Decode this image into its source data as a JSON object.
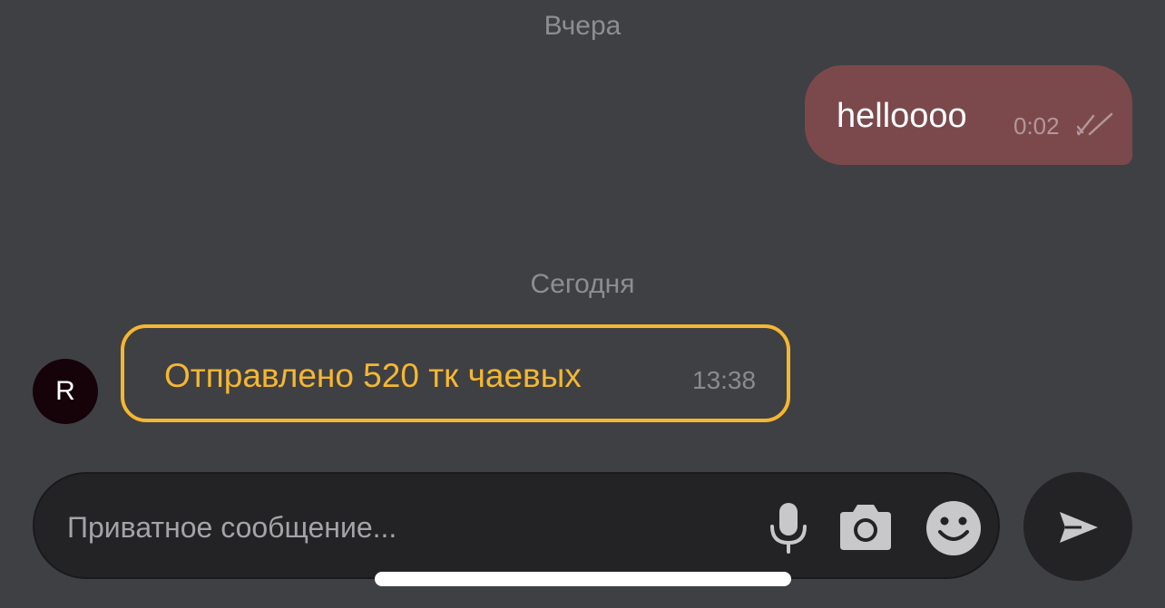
{
  "dates": {
    "yesterday": "Вчера",
    "today": "Сегодня"
  },
  "outgoing_message": {
    "text": "helloooo",
    "time": "0:02",
    "status_icon": "double-check-icon",
    "bubble_color": "#7b494c"
  },
  "incoming_message": {
    "avatar_initial": "R",
    "text": "Отправлено 520 тк чаевых",
    "time": "13:38",
    "highlight_color": "#f5b731"
  },
  "composer": {
    "placeholder": "Приватное сообщение...",
    "icons": [
      "microphone-icon",
      "camera-icon",
      "emoji-icon",
      "send-icon"
    ]
  },
  "colors": {
    "background": "#3f4044",
    "input_background": "#232325",
    "muted_text": "#8d8e92"
  }
}
